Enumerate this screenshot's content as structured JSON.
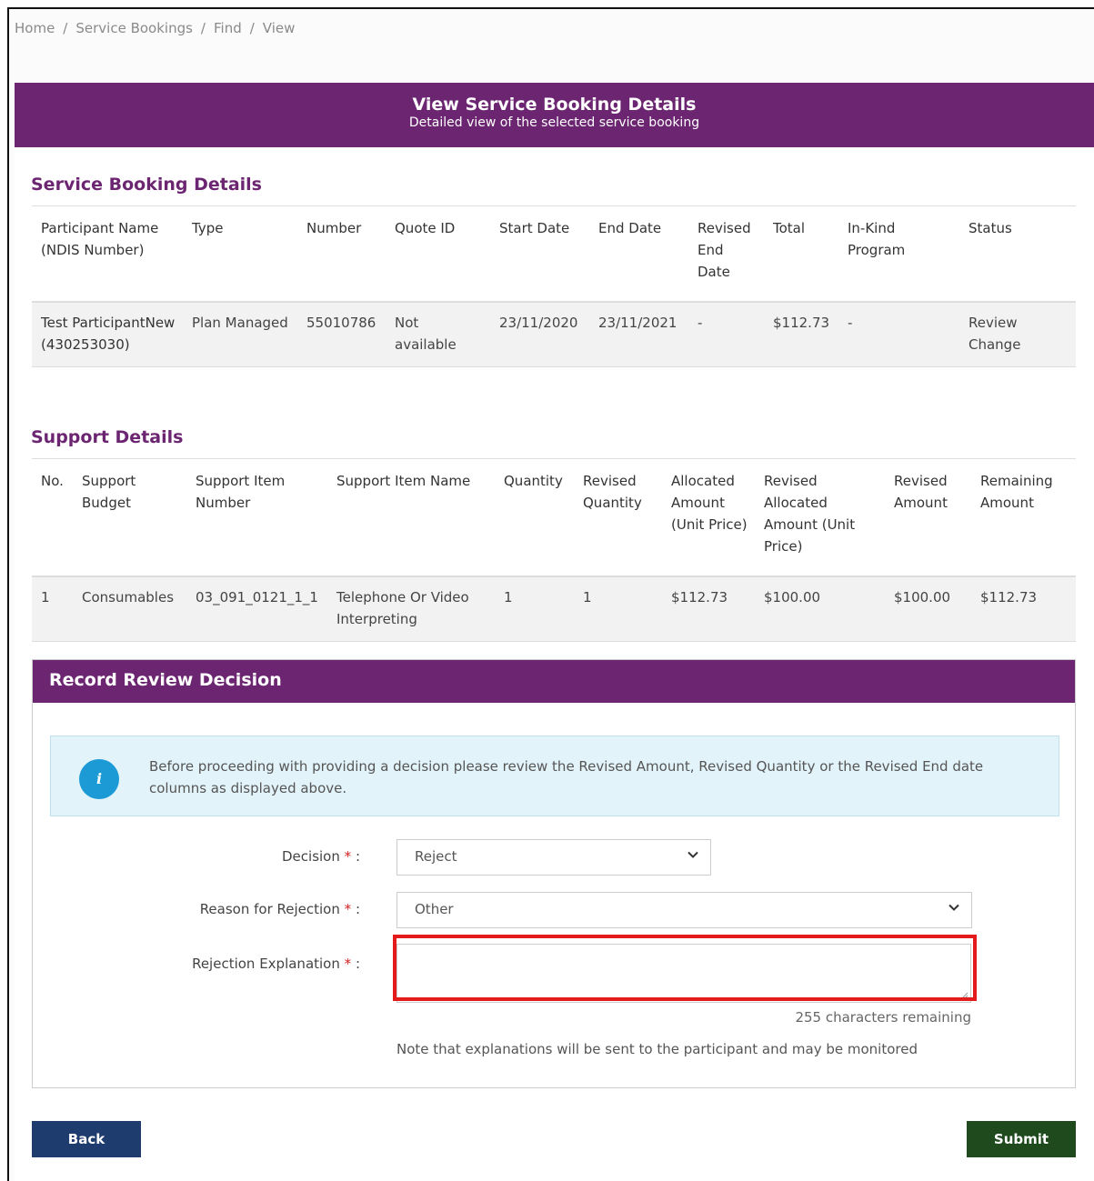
{
  "breadcrumb": [
    "Home",
    "Service Bookings",
    "Find",
    "View"
  ],
  "banner": {
    "title": "View Service Booking Details",
    "subtitle": "Detailed view of the selected service booking"
  },
  "booking": {
    "section_title": "Service Booking Details",
    "headers": [
      "Participant Name (NDIS Number)",
      "Type",
      "Number",
      "Quote ID",
      "Start Date",
      "End Date",
      "Revised End Date",
      "Total",
      "In-Kind Program",
      "Status"
    ],
    "row": {
      "participant": "Test ParticipantNew (430253030)",
      "type": "Plan Managed",
      "number": "55010786",
      "quote_id": "Not available",
      "start_date": "23/11/2020",
      "end_date": "23/11/2021",
      "revised_end_date": "-",
      "total": "$112.73",
      "in_kind": "-",
      "status": "Review Change"
    }
  },
  "support": {
    "section_title": "Support Details",
    "headers": [
      "No.",
      "Support Budget",
      "Support Item Number",
      "Support Item Name",
      "Quantity",
      "Revised Quantity",
      "Allocated Amount (Unit Price)",
      "Revised Allocated Amount (Unit Price)",
      "Revised Amount",
      "Remaining Amount"
    ],
    "row": {
      "no": "1",
      "budget": "Consumables",
      "item_number": "03_091_0121_1_1",
      "item_name": "Telephone Or Video Interpreting",
      "quantity": "1",
      "revised_quantity": "1",
      "allocated": "$112.73",
      "revised_allocated": "$100.00",
      "revised_amount": "$100.00",
      "remaining": "$112.73"
    }
  },
  "review": {
    "title": "Record Review Decision",
    "info": "Before proceeding with providing a decision please review the Revised Amount, Revised Quantity or the Revised End date columns as displayed above.",
    "info_icon": "i",
    "decision_label": "Decision",
    "decision_value": "Reject",
    "reason_label": "Reason for Rejection",
    "reason_value": "Other",
    "explanation_label": "Rejection Explanation",
    "required_mark": "*",
    "label_suffix": ":",
    "chars_remaining": "255 characters remaining",
    "note": "Note that explanations will be sent to the participant and may be monitored"
  },
  "buttons": {
    "back": "Back",
    "submit": "Submit"
  },
  "colors": {
    "brand_purple": "#6c2671",
    "highlight_red": "#e31b1b",
    "back_button": "#1f3c6e",
    "submit_button": "#1e4a1e",
    "info_bg": "#e2f3fa",
    "info_icon": "#1b9ad6"
  }
}
